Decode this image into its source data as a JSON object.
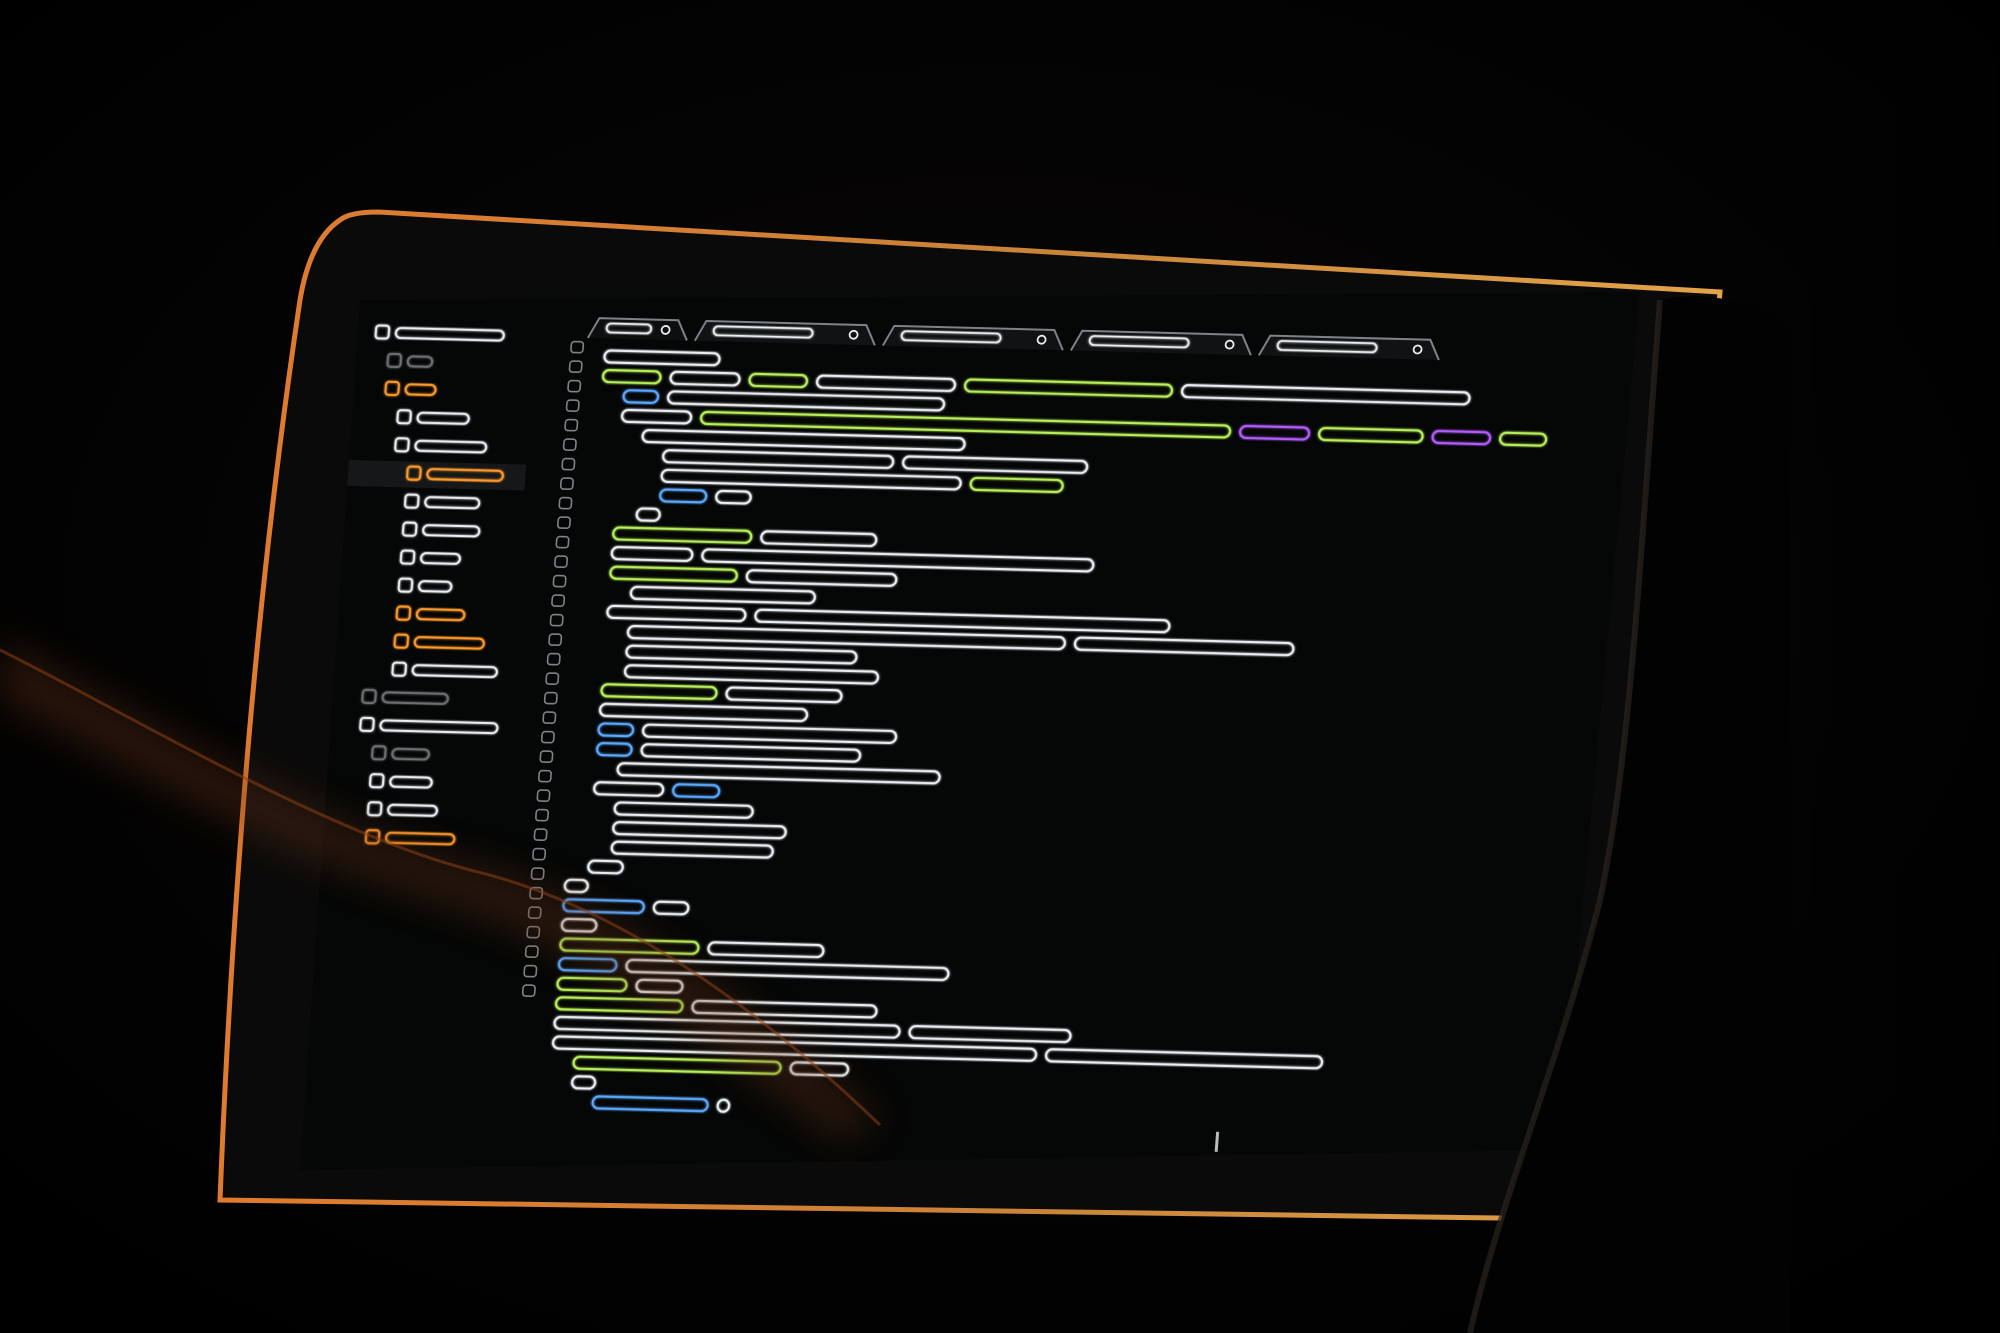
{
  "scene": {
    "description_kind": "photo",
    "colors": {
      "background": "#040303",
      "bezel": "#0b0a0a",
      "bezel_rim": "#d47a2a",
      "screen": "#050606",
      "code_white": "#e9eef2",
      "code_green": "#b7f05a",
      "code_blue": "#5aa8ff",
      "code_orange": "#ff9a2a",
      "code_purple": "#b35cff",
      "gutter_yellow": "#e8d24a",
      "shadow": "#000000"
    },
    "icons": [
      "folder-icon",
      "file-icon",
      "tab-close-icon"
    ]
  },
  "editor": {
    "sidebar_rows": [
      {
        "indent": 0,
        "color": "white",
        "len": 0.72
      },
      {
        "indent": 1,
        "color": "gray",
        "len": 0.18
      },
      {
        "indent": 1,
        "color": "orange",
        "len": 0.22
      },
      {
        "indent": 2,
        "color": "white",
        "len": 0.42
      },
      {
        "indent": 2,
        "color": "white",
        "len": 0.58
      },
      {
        "indent": 3,
        "color": "orange",
        "len": 0.7,
        "selected": true
      },
      {
        "indent": 3,
        "color": "white",
        "len": 0.5
      },
      {
        "indent": 3,
        "color": "white",
        "len": 0.52
      },
      {
        "indent": 3,
        "color": "white",
        "len": 0.36
      },
      {
        "indent": 3,
        "color": "white",
        "len": 0.3
      },
      {
        "indent": 3,
        "color": "orange",
        "len": 0.44
      },
      {
        "indent": 3,
        "color": "orange",
        "len": 0.64
      },
      {
        "indent": 3,
        "color": "white",
        "len": 0.78
      },
      {
        "indent": 1,
        "color": "gray",
        "len": 0.48
      },
      {
        "indent": 1,
        "color": "white",
        "len": 0.86
      },
      {
        "indent": 2,
        "color": "gray",
        "len": 0.3
      },
      {
        "indent": 2,
        "color": "white",
        "len": 0.34
      },
      {
        "indent": 2,
        "color": "white",
        "len": 0.4
      },
      {
        "indent": 2,
        "color": "orange",
        "len": 0.56
      }
    ],
    "tabs": [
      {
        "width": 0.55,
        "active": true
      },
      {
        "width": 1.0
      },
      {
        "width": 1.0
      },
      {
        "width": 1.0
      },
      {
        "width": 1.0
      }
    ],
    "code_lines": [
      [
        [
          "white",
          1.0
        ]
      ],
      [
        [
          "green",
          0.5
        ],
        [
          "white",
          0.6
        ],
        [
          "green",
          0.5
        ],
        [
          "white",
          1.2
        ],
        [
          "green",
          1.8
        ],
        [
          "white",
          2.5
        ]
      ],
      [
        [
          "blue",
          0.3
        ],
        [
          "white",
          2.4
        ]
      ],
      [
        [
          "white",
          0.6
        ],
        [
          "green",
          4.6
        ],
        [
          "purple",
          0.6
        ],
        [
          "green",
          0.9
        ],
        [
          "purple",
          0.5
        ],
        [
          "green",
          0.4
        ]
      ],
      [
        [
          "white",
          2.8
        ]
      ],
      [
        [
          "white",
          2.0
        ],
        [
          "white",
          1.6
        ]
      ],
      [
        [
          "white",
          2.6
        ],
        [
          "green",
          0.8
        ]
      ],
      [
        [
          "blue",
          0.4
        ],
        [
          "white",
          0.3
        ]
      ],
      [
        [
          "white",
          0.2
        ]
      ],
      [
        [
          "green",
          1.2
        ],
        [
          "white",
          1.0
        ]
      ],
      [
        [
          "white",
          0.7
        ],
        [
          "white",
          3.4
        ]
      ],
      [
        [
          "green",
          1.1
        ],
        [
          "white",
          1.3
        ]
      ],
      [
        [
          "white",
          1.6
        ]
      ],
      [
        [
          "white",
          1.2
        ],
        [
          "white",
          3.6
        ]
      ],
      [
        [
          "white",
          3.8
        ],
        [
          "white",
          1.9
        ]
      ],
      [
        [
          "white",
          2.0
        ]
      ],
      [
        [
          "white",
          2.2
        ]
      ],
      [
        [
          "green",
          1.0
        ],
        [
          "white",
          1.0
        ]
      ],
      [
        [
          "white",
          1.8
        ]
      ],
      [
        [
          "blue",
          0.3
        ],
        [
          "white",
          2.2
        ]
      ],
      [
        [
          "blue",
          0.3
        ],
        [
          "white",
          1.9
        ]
      ],
      [
        [
          "white",
          2.8
        ]
      ],
      [
        [
          "white",
          0.6
        ],
        [
          "blue",
          0.4
        ]
      ],
      [
        [
          "white",
          1.2
        ]
      ],
      [
        [
          "white",
          1.5
        ]
      ],
      [
        [
          "white",
          1.4
        ]
      ],
      [
        [
          "white",
          0.3
        ]
      ],
      [
        [
          "white",
          0.2
        ]
      ],
      [
        [
          "blue",
          0.7
        ],
        [
          "white",
          0.3
        ]
      ],
      [
        [
          "white",
          0.3
        ]
      ],
      [
        [
          "green",
          1.2
        ],
        [
          "white",
          1.0
        ]
      ],
      [
        [
          "blue",
          0.5
        ],
        [
          "white",
          2.8
        ]
      ],
      [
        [
          "green",
          0.6
        ],
        [
          "white",
          0.4
        ]
      ],
      [
        [
          "green",
          1.1
        ],
        [
          "white",
          1.6
        ]
      ],
      [
        [
          "white",
          3.0
        ],
        [
          "white",
          1.4
        ]
      ],
      [
        [
          "white",
          4.2
        ],
        [
          "white",
          2.4
        ]
      ],
      [
        [
          "green",
          1.8
        ],
        [
          "white",
          0.5
        ]
      ],
      [
        [
          "white",
          0.2
        ]
      ],
      [
        [
          "blue",
          1.0
        ],
        [
          "white",
          0.1
        ]
      ]
    ]
  }
}
